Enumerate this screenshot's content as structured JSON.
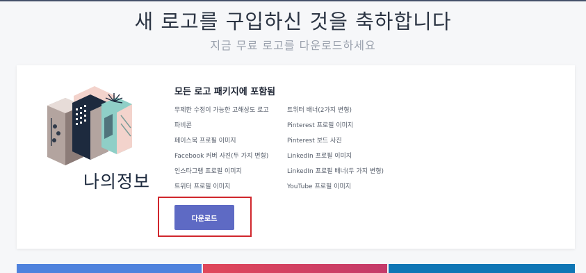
{
  "header": {
    "title": "새 로고를 구입하신 것을 축하합니다",
    "subtitle": "지금 무료 로고를 다운로드하세요"
  },
  "logo": {
    "text": "나의정보",
    "icon": "city-buildings-logo-icon"
  },
  "package": {
    "title": "모든 로고 패키지에 포함됨",
    "items_left": [
      "무제한 수정이 가능한 고해상도 로고",
      "파비콘",
      "페이스북 프로필 이미지",
      "Facebook 커버 사진(두 가지 변형)",
      "인스타그램 프로필 이미지",
      "트위터 프로필 이미지"
    ],
    "items_right": [
      "트위터 배너(2가지 변형)",
      "Pinterest 프로필 이미지",
      "Pinterest 보드 사진",
      "LinkedIn 프로필 이미지",
      "LinkedIn 프로필 배너(두 가지 변형)",
      "YouTube 프로필 이미지"
    ]
  },
  "actions": {
    "download_label": "다운로드"
  },
  "colors": {
    "button": "#5e6ac4",
    "highlight": "#d0262c",
    "facebook": "#4f82dd",
    "pinterest": "#e0475a",
    "linkedin": "#0f76b5"
  }
}
